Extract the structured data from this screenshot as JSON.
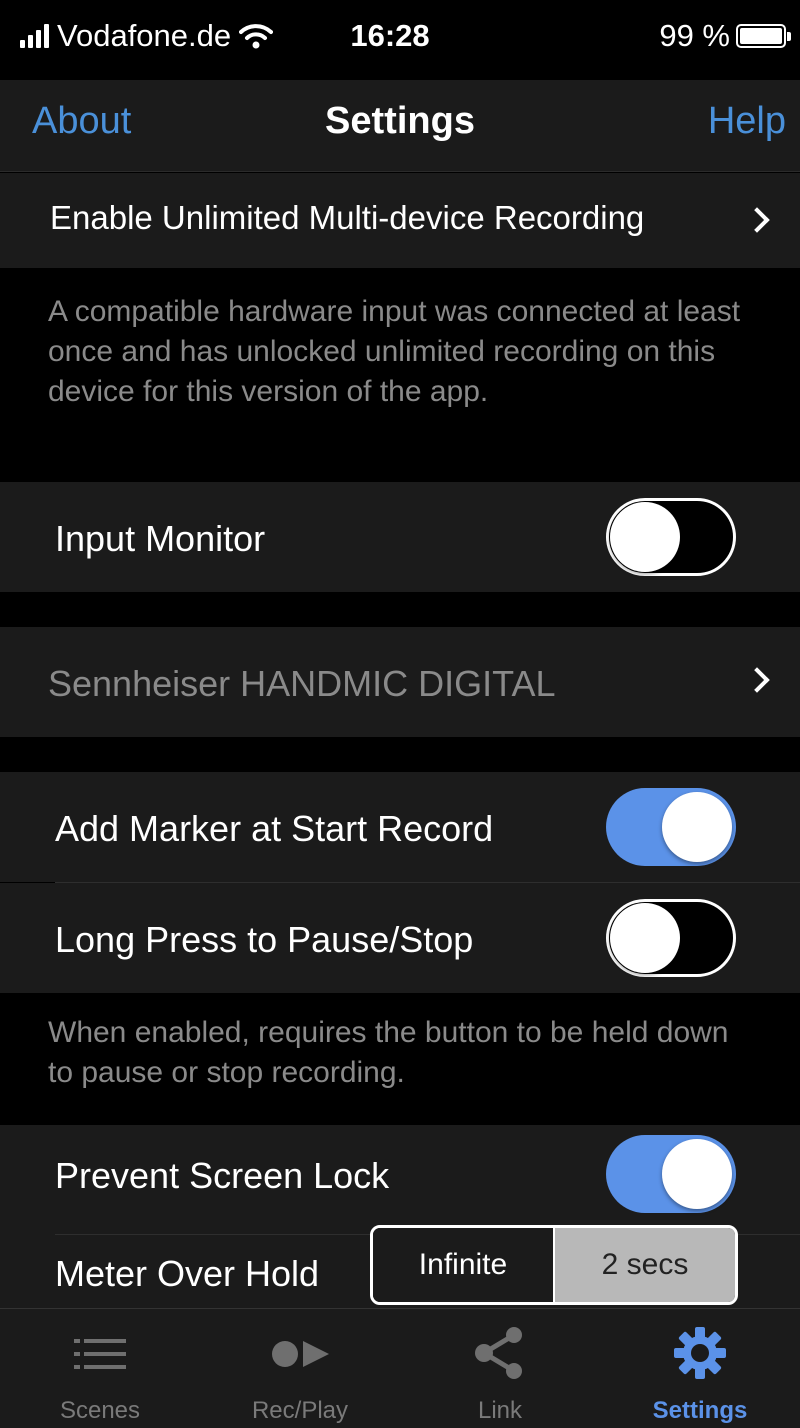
{
  "status_bar": {
    "carrier": "Vodafone.de",
    "time": "16:28",
    "battery": "99 %",
    "battery_level": 0.99
  },
  "nav": {
    "left": "About",
    "title": "Settings",
    "right": "Help"
  },
  "unlimited": {
    "label": "Enable Unlimited Multi-device Recording",
    "description": "A compatible hardware input was connected at least once and has unlocked unlimited recording on this device for this version of the app."
  },
  "input_monitor": {
    "label": "Input Monitor",
    "enabled": false
  },
  "device": {
    "label": "Sennheiser HANDMIC DIGITAL"
  },
  "add_marker": {
    "label": "Add Marker at Start Record",
    "enabled": true
  },
  "long_press": {
    "label": "Long Press to Pause/Stop",
    "enabled": false,
    "description": "When enabled, requires the button to be held down to pause or stop recording."
  },
  "prevent_lock": {
    "label": "Prevent Screen Lock",
    "enabled": true
  },
  "meter_hold": {
    "label": "Meter Over Hold",
    "options": [
      "Infinite",
      "2 secs"
    ],
    "selected": "2 secs"
  },
  "tabs": [
    {
      "label": "Scenes",
      "icon": "list-icon",
      "active": false
    },
    {
      "label": "Rec/Play",
      "icon": "rec-play-icon",
      "active": false
    },
    {
      "label": "Link",
      "icon": "share-icon",
      "active": false
    },
    {
      "label": "Settings",
      "icon": "gear-icon",
      "active": true
    }
  ],
  "colors": {
    "accent": "#5b92e8",
    "link": "#4a90d9",
    "background": "#000000",
    "cell": "#1b1b1b",
    "secondary_text": "#8a8a8a",
    "disabled_text": "#8a8a8a"
  }
}
